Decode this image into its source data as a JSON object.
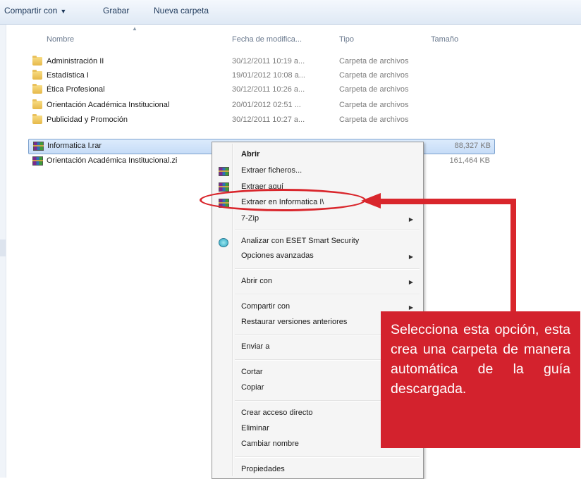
{
  "toolbar": {
    "share_label": "Compartir con",
    "burn_label": "Grabar",
    "new_folder_label": "Nueva carpeta"
  },
  "columns": {
    "name": "Nombre",
    "date": "Fecha de modifica...",
    "type": "Tipo",
    "size": "Tamaño"
  },
  "files": [
    {
      "name": "Administración II",
      "date": "30/12/2011 10:19 a...",
      "type": "Carpeta de archivos",
      "size": "",
      "icon": "folder-icon"
    },
    {
      "name": "Estadística I",
      "date": "19/01/2012 10:08 a...",
      "type": "Carpeta de archivos",
      "size": "",
      "icon": "folder-icon"
    },
    {
      "name": "Ética Profesional",
      "date": "30/12/2011 10:26 a...",
      "type": "Carpeta de archivos",
      "size": "",
      "icon": "folder-icon"
    },
    {
      "name": "Orientación Académica Institucional",
      "date": "20/01/2012 02:51 ...",
      "type": "Carpeta de archivos",
      "size": "",
      "icon": "folder-icon"
    },
    {
      "name": "Publicidad y Promoción",
      "date": "30/12/2011 10:27 a...",
      "type": "Carpeta de archivos",
      "size": "",
      "icon": "folder-icon"
    },
    {
      "name": "Informatica I.rar",
      "date": "",
      "type": "",
      "size": "88,327 KB",
      "icon": "rar-icon",
      "selected": true
    },
    {
      "name": "Orientación Académica Institucional.zi",
      "date": "",
      "type": "",
      "size": "161,464 KB",
      "icon": "rar-icon"
    }
  ],
  "context_menu": {
    "open": "Abrir",
    "extract_files": "Extraer ficheros...",
    "extract_here": "Extraer aquí",
    "extract_to": "Extraer en Informatica I\\",
    "sevenzip": "7-Zip",
    "scan_eset": "Analizar con ESET Smart Security",
    "advanced": "Opciones avanzadas",
    "open_with": "Abrir con",
    "share_with": "Compartir con",
    "restore": "Restaurar versiones anteriores",
    "send_to": "Enviar a",
    "cut": "Cortar",
    "copy": "Copiar",
    "create_shortcut": "Crear acceso directo",
    "delete": "Eliminar",
    "rename": "Cambiar nombre",
    "properties": "Propiedades"
  },
  "callout": {
    "text": "Selecciona esta opción, esta crea una carpeta de manera automática de la guía descargada."
  },
  "colors": {
    "annotation_red": "#d9262c",
    "callout_bg": "#d3222d",
    "selection_blue": "#c6dcf7"
  }
}
